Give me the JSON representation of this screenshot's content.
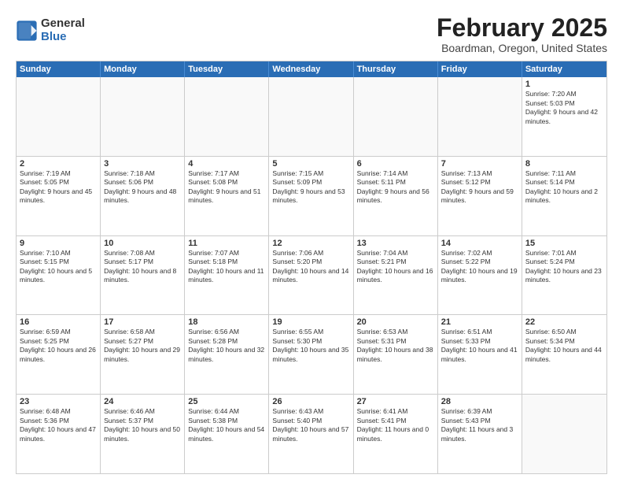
{
  "logo": {
    "general": "General",
    "blue": "Blue"
  },
  "title": "February 2025",
  "location": "Boardman, Oregon, United States",
  "days": [
    "Sunday",
    "Monday",
    "Tuesday",
    "Wednesday",
    "Thursday",
    "Friday",
    "Saturday"
  ],
  "weeks": [
    [
      {
        "day": "",
        "text": ""
      },
      {
        "day": "",
        "text": ""
      },
      {
        "day": "",
        "text": ""
      },
      {
        "day": "",
        "text": ""
      },
      {
        "day": "",
        "text": ""
      },
      {
        "day": "",
        "text": ""
      },
      {
        "day": "1",
        "text": "Sunrise: 7:20 AM\nSunset: 5:03 PM\nDaylight: 9 hours and 42 minutes."
      }
    ],
    [
      {
        "day": "2",
        "text": "Sunrise: 7:19 AM\nSunset: 5:05 PM\nDaylight: 9 hours and 45 minutes."
      },
      {
        "day": "3",
        "text": "Sunrise: 7:18 AM\nSunset: 5:06 PM\nDaylight: 9 hours and 48 minutes."
      },
      {
        "day": "4",
        "text": "Sunrise: 7:17 AM\nSunset: 5:08 PM\nDaylight: 9 hours and 51 minutes."
      },
      {
        "day": "5",
        "text": "Sunrise: 7:15 AM\nSunset: 5:09 PM\nDaylight: 9 hours and 53 minutes."
      },
      {
        "day": "6",
        "text": "Sunrise: 7:14 AM\nSunset: 5:11 PM\nDaylight: 9 hours and 56 minutes."
      },
      {
        "day": "7",
        "text": "Sunrise: 7:13 AM\nSunset: 5:12 PM\nDaylight: 9 hours and 59 minutes."
      },
      {
        "day": "8",
        "text": "Sunrise: 7:11 AM\nSunset: 5:14 PM\nDaylight: 10 hours and 2 minutes."
      }
    ],
    [
      {
        "day": "9",
        "text": "Sunrise: 7:10 AM\nSunset: 5:15 PM\nDaylight: 10 hours and 5 minutes."
      },
      {
        "day": "10",
        "text": "Sunrise: 7:08 AM\nSunset: 5:17 PM\nDaylight: 10 hours and 8 minutes."
      },
      {
        "day": "11",
        "text": "Sunrise: 7:07 AM\nSunset: 5:18 PM\nDaylight: 10 hours and 11 minutes."
      },
      {
        "day": "12",
        "text": "Sunrise: 7:06 AM\nSunset: 5:20 PM\nDaylight: 10 hours and 14 minutes."
      },
      {
        "day": "13",
        "text": "Sunrise: 7:04 AM\nSunset: 5:21 PM\nDaylight: 10 hours and 16 minutes."
      },
      {
        "day": "14",
        "text": "Sunrise: 7:02 AM\nSunset: 5:22 PM\nDaylight: 10 hours and 19 minutes."
      },
      {
        "day": "15",
        "text": "Sunrise: 7:01 AM\nSunset: 5:24 PM\nDaylight: 10 hours and 23 minutes."
      }
    ],
    [
      {
        "day": "16",
        "text": "Sunrise: 6:59 AM\nSunset: 5:25 PM\nDaylight: 10 hours and 26 minutes."
      },
      {
        "day": "17",
        "text": "Sunrise: 6:58 AM\nSunset: 5:27 PM\nDaylight: 10 hours and 29 minutes."
      },
      {
        "day": "18",
        "text": "Sunrise: 6:56 AM\nSunset: 5:28 PM\nDaylight: 10 hours and 32 minutes."
      },
      {
        "day": "19",
        "text": "Sunrise: 6:55 AM\nSunset: 5:30 PM\nDaylight: 10 hours and 35 minutes."
      },
      {
        "day": "20",
        "text": "Sunrise: 6:53 AM\nSunset: 5:31 PM\nDaylight: 10 hours and 38 minutes."
      },
      {
        "day": "21",
        "text": "Sunrise: 6:51 AM\nSunset: 5:33 PM\nDaylight: 10 hours and 41 minutes."
      },
      {
        "day": "22",
        "text": "Sunrise: 6:50 AM\nSunset: 5:34 PM\nDaylight: 10 hours and 44 minutes."
      }
    ],
    [
      {
        "day": "23",
        "text": "Sunrise: 6:48 AM\nSunset: 5:36 PM\nDaylight: 10 hours and 47 minutes."
      },
      {
        "day": "24",
        "text": "Sunrise: 6:46 AM\nSunset: 5:37 PM\nDaylight: 10 hours and 50 minutes."
      },
      {
        "day": "25",
        "text": "Sunrise: 6:44 AM\nSunset: 5:38 PM\nDaylight: 10 hours and 54 minutes."
      },
      {
        "day": "26",
        "text": "Sunrise: 6:43 AM\nSunset: 5:40 PM\nDaylight: 10 hours and 57 minutes."
      },
      {
        "day": "27",
        "text": "Sunrise: 6:41 AM\nSunset: 5:41 PM\nDaylight: 11 hours and 0 minutes."
      },
      {
        "day": "28",
        "text": "Sunrise: 6:39 AM\nSunset: 5:43 PM\nDaylight: 11 hours and 3 minutes."
      },
      {
        "day": "",
        "text": ""
      }
    ]
  ],
  "colors": {
    "header_bg": "#2a6db5",
    "alt_row": "#f0f4fa"
  }
}
